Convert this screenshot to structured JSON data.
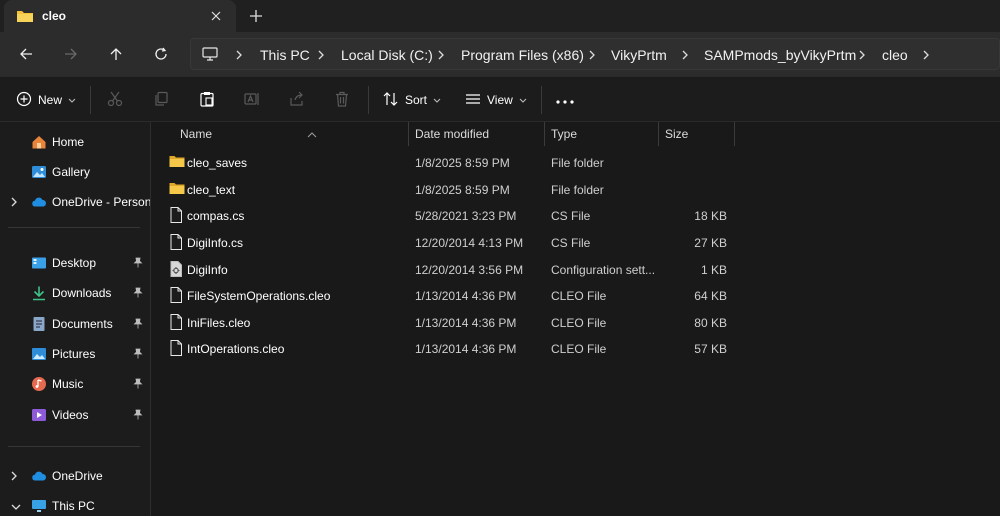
{
  "tab": {
    "title": "cleo"
  },
  "address": {
    "crumbs": [
      "This PC",
      "Local Disk (C:)",
      "Program Files (x86)",
      "VikyPrtm",
      "SAMPmods_byVikyPrtm",
      "cleo"
    ]
  },
  "toolbar": {
    "new_label": "New",
    "sort_label": "Sort",
    "view_label": "View"
  },
  "sidebar": {
    "items": [
      {
        "label": "Home"
      },
      {
        "label": "Gallery"
      },
      {
        "label": "OneDrive - Personal"
      },
      {
        "label": "Desktop"
      },
      {
        "label": "Downloads"
      },
      {
        "label": "Documents"
      },
      {
        "label": "Pictures"
      },
      {
        "label": "Music"
      },
      {
        "label": "Videos"
      },
      {
        "label": "OneDrive"
      },
      {
        "label": "This PC"
      }
    ]
  },
  "columns": {
    "name": "Name",
    "date": "Date modified",
    "type": "Type",
    "size": "Size"
  },
  "files": [
    {
      "name": "cleo_saves",
      "date": "1/8/2025 8:59 PM",
      "type": "File folder",
      "size": "",
      "icon": "folder-icon"
    },
    {
      "name": "cleo_text",
      "date": "1/8/2025 8:59 PM",
      "type": "File folder",
      "size": "",
      "icon": "folder-icon"
    },
    {
      "name": "compas.cs",
      "date": "5/28/2021 3:23 PM",
      "type": "CS File",
      "size": "18 KB",
      "icon": "file-icon"
    },
    {
      "name": "DigiInfo.cs",
      "date": "12/20/2014 4:13 PM",
      "type": "CS File",
      "size": "27 KB",
      "icon": "file-icon"
    },
    {
      "name": "DigiInfo",
      "date": "12/20/2014 3:56 PM",
      "type": "Configuration sett...",
      "size": "1 KB",
      "icon": "settings-file-icon"
    },
    {
      "name": "FileSystemOperations.cleo",
      "date": "1/13/2014 4:36 PM",
      "type": "CLEO File",
      "size": "64 KB",
      "icon": "file-icon"
    },
    {
      "name": "IniFiles.cleo",
      "date": "1/13/2014 4:36 PM",
      "type": "CLEO File",
      "size": "80 KB",
      "icon": "file-icon"
    },
    {
      "name": "IntOperations.cleo",
      "date": "1/13/2014 4:36 PM",
      "type": "CLEO File",
      "size": "57 KB",
      "icon": "file-icon"
    }
  ],
  "colors": {
    "folder": "#f3c13a",
    "accent": "#4cc2ff",
    "background": "#191919"
  }
}
